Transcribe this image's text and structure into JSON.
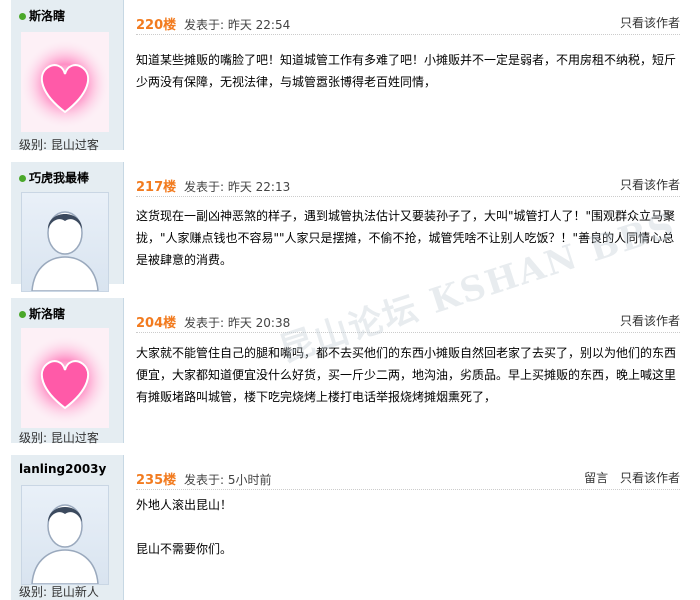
{
  "posts": [
    {
      "username": "斯洛瞎",
      "level": "级别: 昆山过客",
      "floor": "220楼",
      "posted": "发表于: 昨天 22:54",
      "links": [
        "只看该作者"
      ],
      "lines": [
        "知道某些摊贩的嘴脸了吧！知道城管工作有多难了吧！小摊贩并不一定是弱者，不用房租不纳税，短斤",
        "少两没有保障，无视法律，与城管嚣张博得老百姓同情，"
      ]
    },
    {
      "username": "巧虎我最棒",
      "level": "",
      "floor": "217楼",
      "posted": "发表于: 昨天 22:13",
      "links": [
        "只看该作者"
      ],
      "lines": [
        "这货现在一副凶神恶煞的样子，遇到城管执法估计又要装孙子了，大叫\"城管打人了！\"围观群众立马聚",
        "拢，\"人家赚点钱也不容易\"\"人家只是摆摊，不偷不抢，城管凭啥不让别人吃饭？！\"善良的人同情心总",
        "是被肆意的消费。"
      ]
    },
    {
      "username": "斯洛瞎",
      "level": "级别: 昆山过客",
      "floor": "204楼",
      "posted": "发表于: 昨天 20:38",
      "links": [
        "只看该作者"
      ],
      "lines": [
        "大家就不能管住自己的腿和嘴吗，都不去买他们的东西小摊贩自然回老家了去买了，别以为他们的东西",
        "便宜，大家都知道便宜没什么好货，买一斤少二两，地沟油，劣质品。早上买摊贩的东西，晚上喊这里",
        "有摊贩堵路叫城管，楼下吃完烧烤上楼打电话举报烧烤摊烟熏死了，"
      ]
    },
    {
      "username": "lanling2003y",
      "level": "级别: 昆山新人",
      "floor": "235楼",
      "posted": "发表于: 5小时前",
      "links": [
        "留言",
        "只看该作者"
      ],
      "lines": [
        "外地人滚出昆山！",
        "",
        "昆山不需要你们。"
      ]
    }
  ],
  "watermark": "昆山论坛 KSHAN BBS",
  "colors": {
    "floor": "#f27b1f",
    "sidebar": "#e5edf2",
    "online_dot": "#4aa82a"
  }
}
